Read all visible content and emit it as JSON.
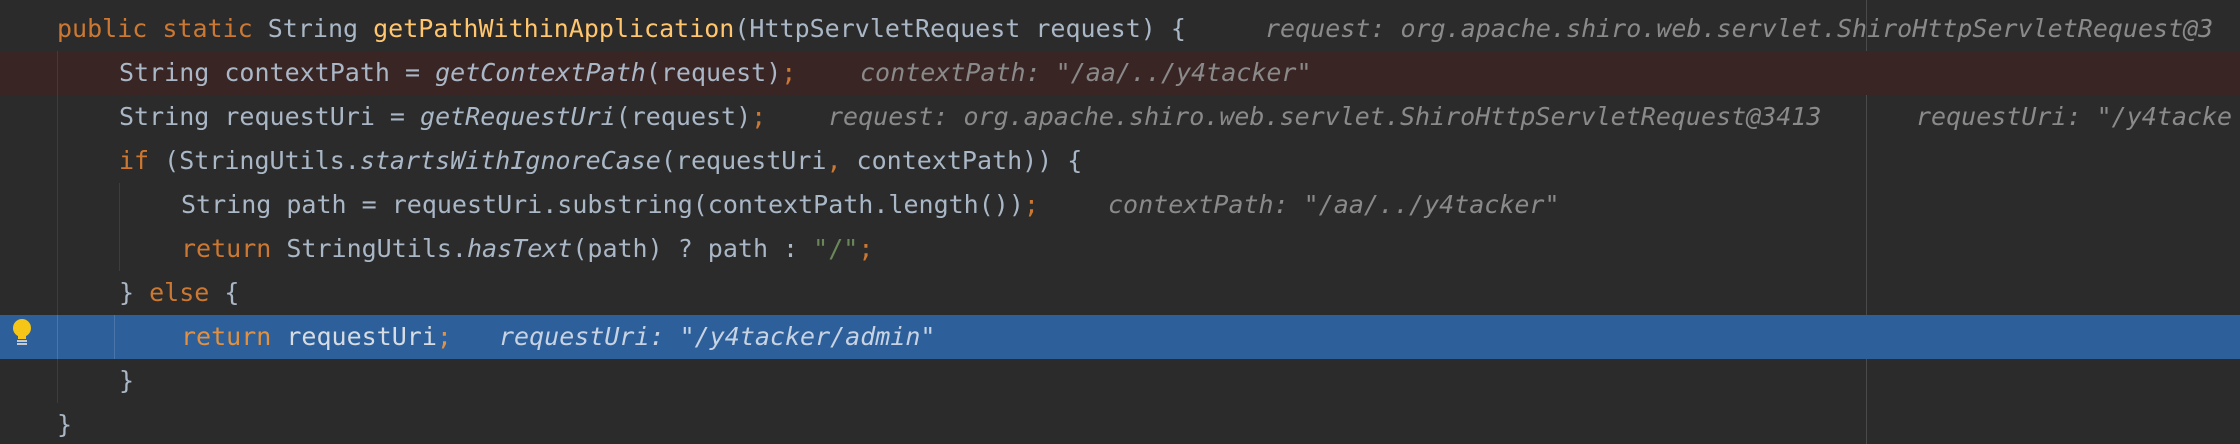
{
  "lines": [
    {
      "parts": {
        "kw1": "public",
        "kw2": "static",
        "type": "String",
        "method": "getPathWithinApplication",
        "params": "(HttpServletRequest request) {",
        "hint": "request: org.apache.shiro.web.servlet.ShiroHttpServletRequest@3"
      }
    },
    {
      "parts": {
        "decl": "String contextPath = ",
        "call": "getContextPath",
        "args": "(request)",
        "semi": ";",
        "hint": "contextPath: \"/aa/../y4tacker\""
      }
    },
    {
      "parts": {
        "decl": "String requestUri = ",
        "call": "getRequestUri",
        "args": "(request)",
        "semi": ";",
        "hint1": "request: org.apache.shiro.web.servlet.ShiroHttpServletRequest@3413",
        "hint2": "requestUri: \"/y4tacke"
      }
    },
    {
      "parts": {
        "kw": "if",
        "pre": " (StringUtils.",
        "call": "startsWithIgnoreCase",
        "args1": "(requestUri",
        "comma": ",",
        "args2": " contextPath)) {"
      }
    },
    {
      "parts": {
        "code": "String path = requestUri.substring(contextPath.length())",
        "semi": ";",
        "hint": "contextPath: \"/aa/../y4tacker\""
      }
    },
    {
      "parts": {
        "kw": "return",
        "pre": " StringUtils.",
        "call": "hasText",
        "mid": "(path) ? path : ",
        "str": "\"/\"",
        "semi": ";"
      }
    },
    {
      "parts": {
        "brace": "} ",
        "kw": "else",
        "rest": " {"
      }
    },
    {
      "parts": {
        "kw": "return",
        "id": " requestUri",
        "semi": ";",
        "hint": "requestUri: \"/y4tacker/admin\""
      }
    },
    {
      "parts": {
        "brace": "}"
      }
    },
    {
      "parts": {
        "brace": "}"
      }
    }
  ],
  "colors": {
    "background": "#2b2b2b",
    "keyword": "#cc7832",
    "method": "#ffc66d",
    "string": "#6a8759",
    "default_text": "#a9b7c6",
    "inlay_hint": "#8a8a8a",
    "execution_line": "#2d5f9a",
    "error_line": "#3a2525"
  },
  "gutter": {
    "icon": "lightbulb-icon"
  }
}
